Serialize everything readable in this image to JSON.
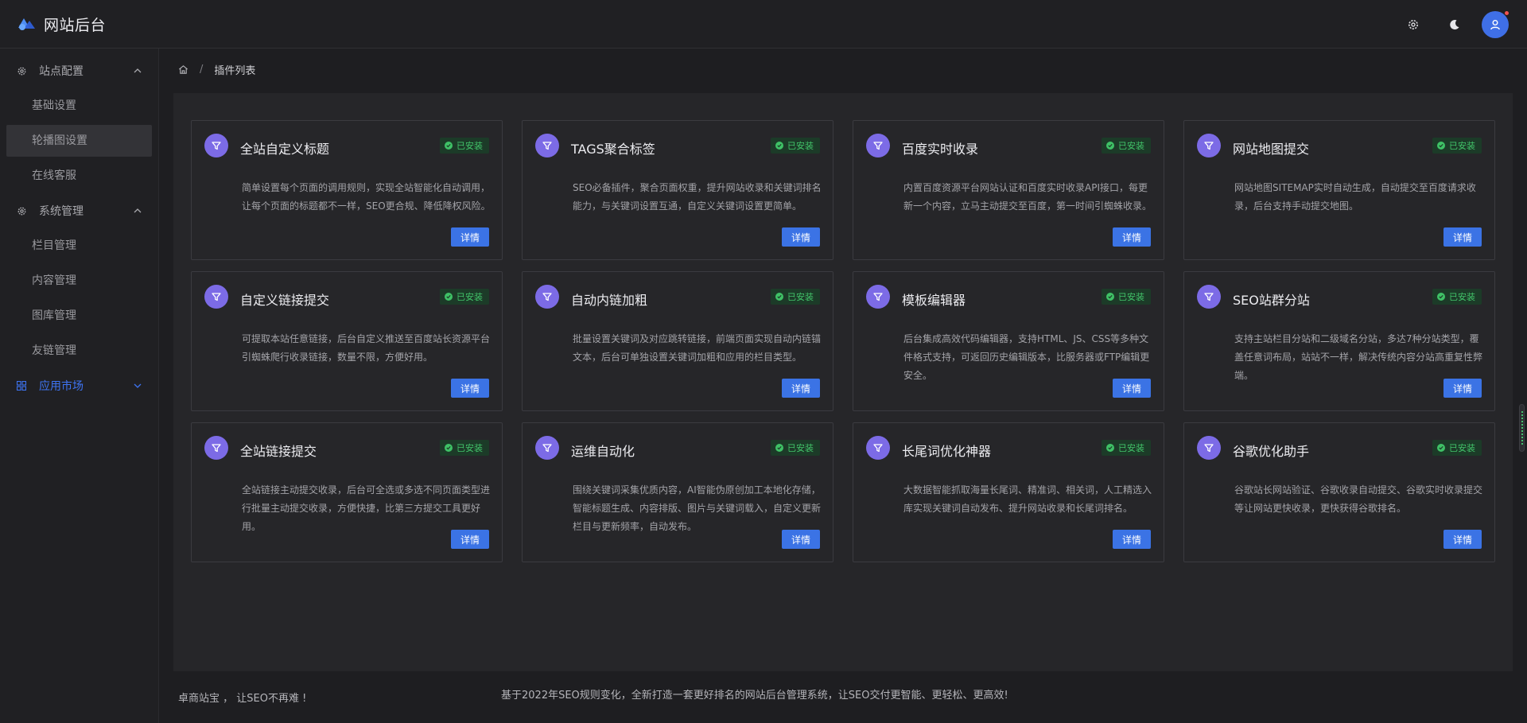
{
  "app": {
    "title": "网站后台"
  },
  "colors": {
    "accent": "#3e74f3",
    "installed": "#42c46a",
    "plugin_icon": "#7c6be6"
  },
  "header": {
    "icons": [
      "settings-icon",
      "moon-icon",
      "user-icon"
    ]
  },
  "sidebar": {
    "groups": [
      {
        "label": "站点配置",
        "icon": "gear-icon",
        "expanded": true,
        "items": [
          {
            "label": "基础设置"
          },
          {
            "label": "轮播图设置",
            "active": true
          },
          {
            "label": "在线客服"
          }
        ]
      },
      {
        "label": "系统管理",
        "icon": "gear-icon",
        "expanded": true,
        "items": [
          {
            "label": "栏目管理"
          },
          {
            "label": "内容管理"
          },
          {
            "label": "图库管理"
          },
          {
            "label": "友链管理"
          }
        ]
      },
      {
        "label": "应用市场",
        "icon": "apps-icon",
        "expanded": false,
        "active": true,
        "items": []
      }
    ]
  },
  "breadcrumb": {
    "current": "插件列表"
  },
  "plugins": [
    {
      "title": "全站自定义标题",
      "status": "已安装",
      "desc": "简单设置每个页面的调用规则，实现全站智能化自动调用，让每个页面的标题都不一样，SEO更合规、降低降权风险。",
      "button": "详情"
    },
    {
      "title": "TAGS聚合标签",
      "status": "已安装",
      "desc": "SEO必备插件，聚合页面权重，提升网站收录和关键词排名能力，与关键词设置互通，自定义关键词设置更简单。",
      "button": "详情"
    },
    {
      "title": "百度实时收录",
      "status": "已安装",
      "desc": "内置百度资源平台网站认证和百度实时收录API接口，每更新一个内容，立马主动提交至百度，第一时间引蜘蛛收录。",
      "button": "详情"
    },
    {
      "title": "网站地图提交",
      "status": "已安装",
      "desc": "网站地图SITEMAP实时自动生成，自动提交至百度请求收录，后台支持手动提交地图。",
      "button": "详情"
    },
    {
      "title": "自定义链接提交",
      "status": "已安装",
      "desc": "可提取本站任意链接，后台自定义推送至百度站长资源平台引蜘蛛爬行收录链接，数量不限，方便好用。",
      "button": "详情"
    },
    {
      "title": "自动内链加粗",
      "status": "已安装",
      "desc": "批量设置关键词及对应跳转链接，前端页面实现自动内链锚文本，后台可单独设置关键词加粗和应用的栏目类型。",
      "button": "详情"
    },
    {
      "title": "模板编辑器",
      "status": "已安装",
      "desc": "后台集成高效代码编辑器，支持HTML、JS、CSS等多种文件格式支持，可返回历史编辑版本，比服务器或FTP编辑更安全。",
      "button": "详情"
    },
    {
      "title": "SEO站群分站",
      "status": "已安装",
      "desc": "支持主站栏目分站和二级域名分站，多达7种分站类型，覆盖任意词布局，站站不一样，解决传统内容分站高重复性弊端。",
      "button": "详情"
    },
    {
      "title": "全站链接提交",
      "status": "已安装",
      "desc": "全站链接主动提交收录，后台可全选或多选不同页面类型进行批量主动提交收录，方便快捷，比第三方提交工具更好用。",
      "button": "详情"
    },
    {
      "title": "运维自动化",
      "status": "已安装",
      "desc": "围绕关键词采集优质内容，AI智能伪原创加工本地化存储，智能标题生成、内容排版、图片与关键词载入，自定义更新栏目与更新频率，自动发布。",
      "button": "详情"
    },
    {
      "title": "长尾词优化神器",
      "status": "已安装",
      "desc": "大数据智能抓取海量长尾词、精准词、相关词，人工精选入库实现关键词自动发布、提升网站收录和长尾词排名。",
      "button": "详情"
    },
    {
      "title": "谷歌优化助手",
      "status": "已安装",
      "desc": "谷歌站长网站验证、谷歌收录自动提交、谷歌实时收录提交等让网站更快收录，更快获得谷歌排名。",
      "button": "详情"
    }
  ],
  "footer": {
    "left": "卓商站宝 ，  让SEO不再难 !",
    "center": "基于2022年SEO规则变化，全新打造一套更好排名的网站后台管理系统，让SEO交付更智能、更轻松、更高效!"
  }
}
